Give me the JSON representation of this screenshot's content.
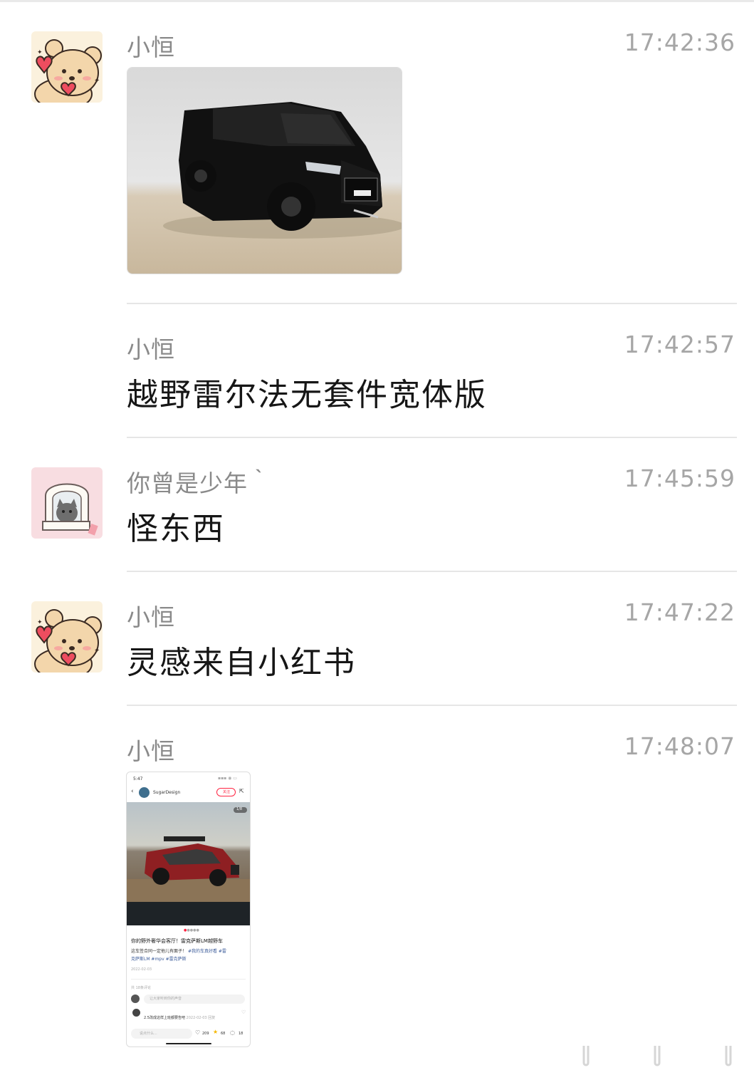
{
  "messages": [
    {
      "sender": "小恒",
      "time": "17:42:36",
      "avatar": "bear-heart-avatar",
      "type": "image",
      "image_desc": "black-lexus-lm-offroad-model"
    },
    {
      "sender": "小恒",
      "time": "17:42:57",
      "type": "text",
      "text": "越野雷尔法无套件宽体版"
    },
    {
      "sender": "你曾是少年｀",
      "time": "17:45:59",
      "avatar": "cat-window-avatar",
      "type": "text",
      "text": "怪东西"
    },
    {
      "sender": "小恒",
      "time": "17:47:22",
      "avatar": "bear-heart-avatar",
      "type": "text",
      "text": "灵感来自小红书"
    },
    {
      "sender": "小恒",
      "time": "17:48:07",
      "type": "screenshot"
    }
  ],
  "screenshot": {
    "status_time": "5:47",
    "author": "SugarDesign",
    "follow_label": "关注",
    "page_counter": "1/8",
    "post_title": "你的野外奢华会客厅！雷克萨斯LM越野车",
    "post_body": "这车签合同一定他儿有面子！",
    "tags_line1": "#我的车真好看 #雷",
    "tags_line2": "克萨斯LM #mpv #雷克萨斯",
    "date": "2022-02-03",
    "comment_count": "共 18条评论",
    "comment_placeholder": "让大家听到你的声音",
    "comment_text": "2.5改成这样上班都要告吧",
    "comment_date": "2022-02-03",
    "reply_label": "回复",
    "bottom_input_placeholder": "说点什么...",
    "likes": "209",
    "stars": "68",
    "comments": "18"
  },
  "colors": {
    "sender": "#8a8a8a",
    "time": "#a6a6a6",
    "text": "#161616",
    "divider": "#e6e6e6",
    "follow": "#ff2442"
  }
}
